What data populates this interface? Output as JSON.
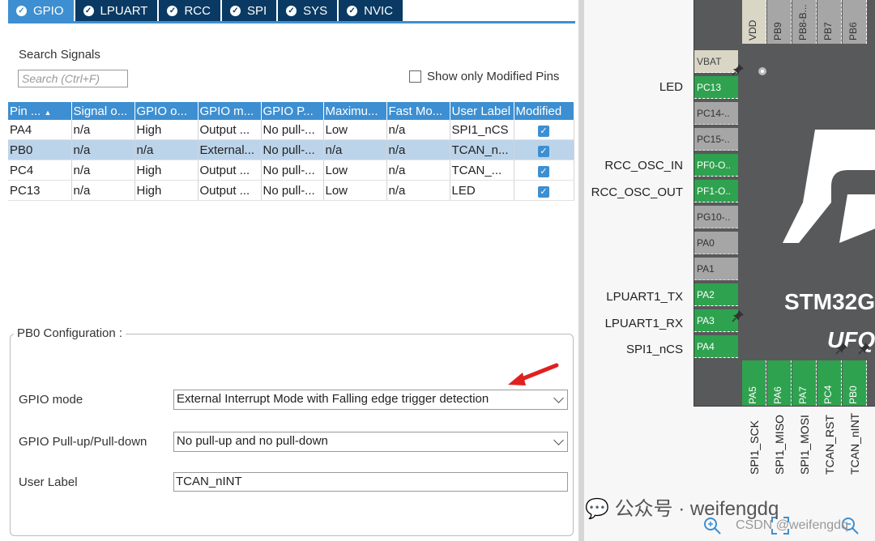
{
  "tabs": [
    {
      "label": "GPIO",
      "active": true
    },
    {
      "label": "LPUART",
      "active": false
    },
    {
      "label": "RCC",
      "active": false
    },
    {
      "label": "SPI",
      "active": false
    },
    {
      "label": "SYS",
      "active": false
    },
    {
      "label": "NVIC",
      "active": false
    }
  ],
  "search": {
    "title": "Search Signals",
    "placeholder": "Search (Ctrl+F)",
    "show_modified_label": "Show only Modified Pins"
  },
  "table": {
    "headers": [
      "Pin ...",
      "Signal o...",
      "GPIO o...",
      "GPIO m...",
      "GPIO P...",
      "Maximu...",
      "Fast Mo...",
      "User Label",
      "Modified"
    ],
    "rows": [
      {
        "cells": [
          "PA4",
          "n/a",
          "High",
          "Output ...",
          "No pull-...",
          "Low",
          "n/a",
          "SPI1_nCS"
        ],
        "modified": true,
        "selected": false
      },
      {
        "cells": [
          "PB0",
          "n/a",
          "n/a",
          "External...",
          "No pull-...",
          "n/a",
          "n/a",
          "TCAN_n..."
        ],
        "modified": true,
        "selected": true
      },
      {
        "cells": [
          "PC4",
          "n/a",
          "High",
          "Output ...",
          "No pull-...",
          "Low",
          "n/a",
          "TCAN_..."
        ],
        "modified": true,
        "selected": false
      },
      {
        "cells": [
          "PC13",
          "n/a",
          "High",
          "Output ...",
          "No pull-...",
          "Low",
          "n/a",
          "LED"
        ],
        "modified": true,
        "selected": false
      }
    ]
  },
  "config": {
    "title": "PB0 Configuration :",
    "gpio_mode_label": "GPIO mode",
    "gpio_mode_value": "External Interrupt Mode with Falling edge trigger detection",
    "pull_label": "GPIO Pull-up/Pull-down",
    "pull_value": "No pull-up and no pull-down",
    "user_label_label": "User Label",
    "user_label_value": "TCAN_nINT"
  },
  "pinout": {
    "top_pins": [
      "VDD",
      "PB9",
      "PB8-B...",
      "PB7",
      "PB6"
    ],
    "left_pins": [
      {
        "name": "VBAT",
        "color": "beige",
        "label": ""
      },
      {
        "name": "PC13",
        "color": "green",
        "label": "LED"
      },
      {
        "name": "PC14-..",
        "color": "gray",
        "label": ""
      },
      {
        "name": "PC15-..",
        "color": "gray",
        "label": ""
      },
      {
        "name": "PF0-O..",
        "color": "green",
        "label": "RCC_OSC_IN"
      },
      {
        "name": "PF1-O..",
        "color": "green",
        "label": "RCC_OSC_OUT"
      },
      {
        "name": "PG10-..",
        "color": "gray",
        "label": ""
      },
      {
        "name": "PA0",
        "color": "gray",
        "label": ""
      },
      {
        "name": "PA1",
        "color": "gray",
        "label": ""
      },
      {
        "name": "PA2",
        "color": "green",
        "label": "LPUART1_TX"
      },
      {
        "name": "PA3",
        "color": "green",
        "label": "LPUART1_RX"
      },
      {
        "name": "PA4",
        "color": "green",
        "label": "SPI1_nCS"
      }
    ],
    "bottom_pins": [
      {
        "name": "PA5",
        "label": "SPI1_SCK"
      },
      {
        "name": "PA6",
        "label": "SPI1_MISO"
      },
      {
        "name": "PA7",
        "label": "SPI1_MOSI"
      },
      {
        "name": "PC4",
        "label": "TCAN_RST"
      },
      {
        "name": "PB0",
        "label": "TCAN_nINT"
      }
    ],
    "chip_name": "STM32G",
    "chip_package": "UFQ"
  },
  "watermark": {
    "line1": "公众号 · weifengdq",
    "line2": "CSDN @weifengdq"
  },
  "colors": {
    "tab_dark": "#0a3a63",
    "tab_active": "#3d8fd1",
    "pin_green": "#2fa24f",
    "chip_body": "#58595b",
    "arrow_red": "#e02020"
  }
}
